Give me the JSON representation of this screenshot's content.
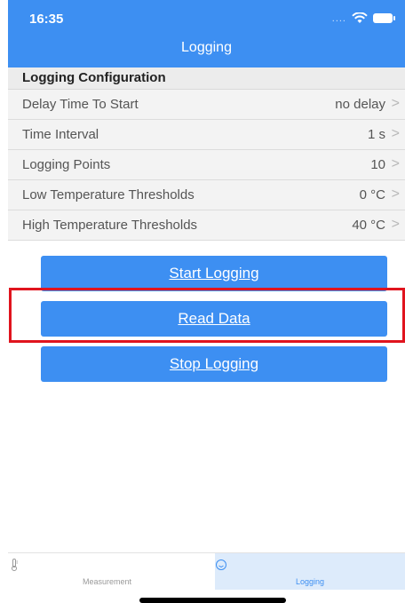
{
  "status_bar": {
    "time": "16:35",
    "signal": "....",
    "wifi_icon": "wifi-icon",
    "battery_icon": "battery-icon"
  },
  "nav": {
    "title": "Logging"
  },
  "section": {
    "title": "Logging Configuration"
  },
  "rows": [
    {
      "label": "Delay Time To Start",
      "value": "no delay"
    },
    {
      "label": "Time Interval",
      "value": "1 s"
    },
    {
      "label": "Logging Points",
      "value": "10"
    },
    {
      "label": "Low Temperature Thresholds",
      "value": "0 °C"
    },
    {
      "label": "High Temperature Thresholds",
      "value": "40 °C"
    }
  ],
  "chevron": ">",
  "buttons": {
    "start": "Start Logging",
    "read": "Read Data",
    "stop": "Stop Logging"
  },
  "tabs": [
    {
      "label": "Measurement",
      "icon": "thermometer-icon",
      "active": false
    },
    {
      "label": "Logging",
      "icon": "clock-icon",
      "active": true
    }
  ],
  "colors": {
    "accent": "#3d8ff2",
    "highlight": "#e0141e",
    "active_tab_bg": "#ddebfb"
  }
}
